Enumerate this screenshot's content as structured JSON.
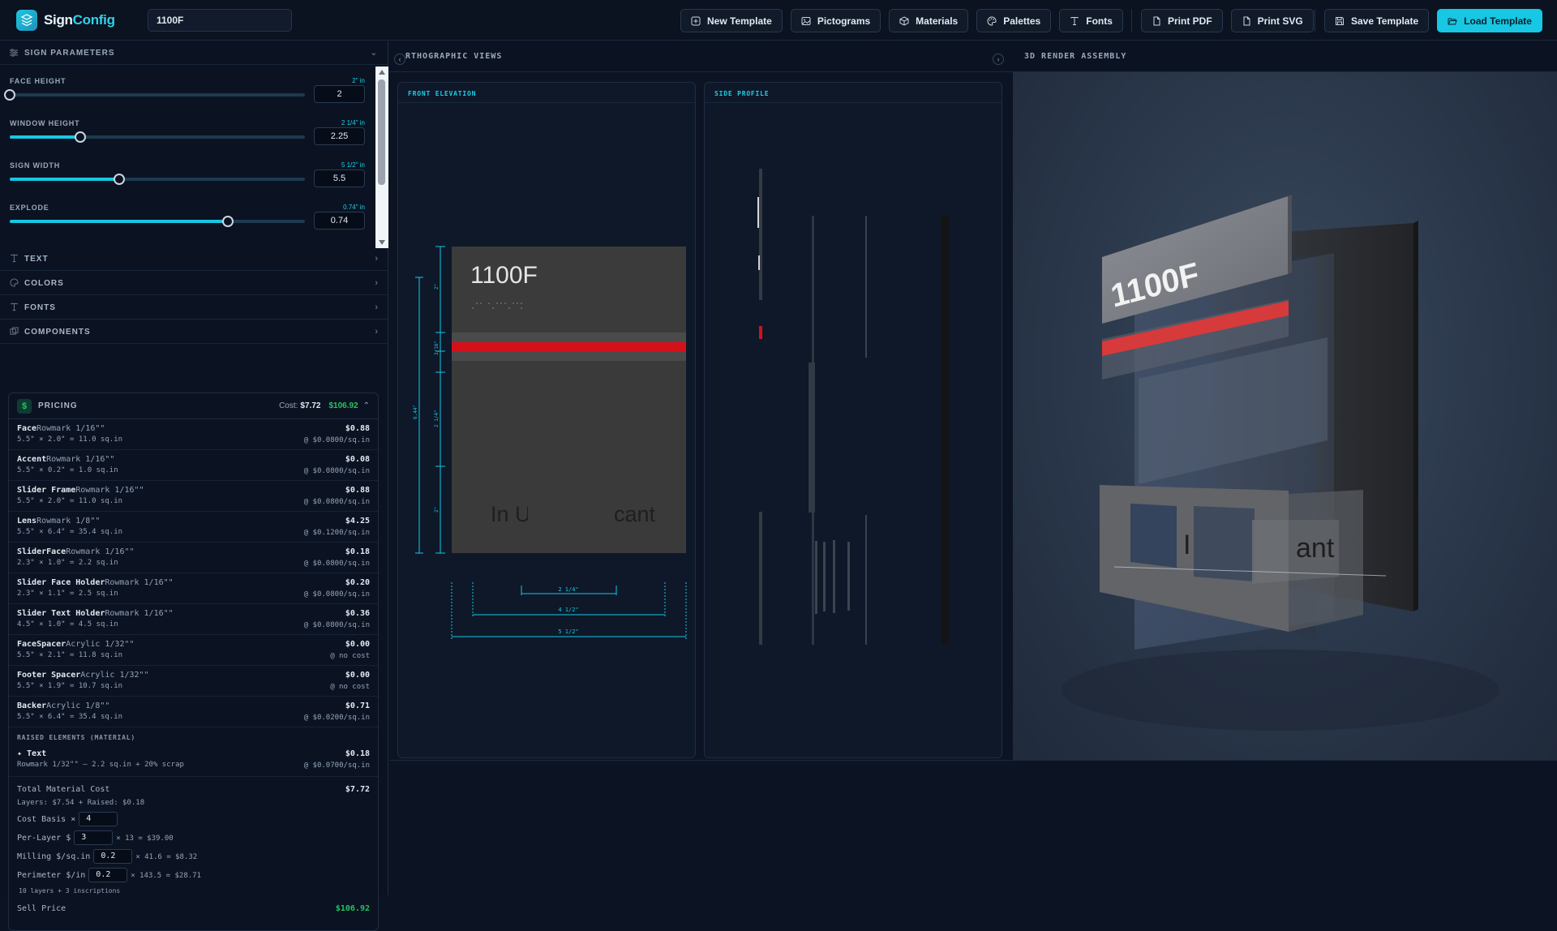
{
  "app": {
    "brand_a": "Sign",
    "brand_b": "Config",
    "template_name": "1100F"
  },
  "toolbar": {
    "new_template": "New Template",
    "pictograms": "Pictograms",
    "materials": "Materials",
    "palettes": "Palettes",
    "fonts": "Fonts",
    "print_pdf": "Print PDF",
    "print_svg": "Print SVG",
    "save_template": "Save Template",
    "load_template": "Load Template"
  },
  "sign_parameters": {
    "title": "SIGN PARAMETERS",
    "params": [
      {
        "label": "FACE HEIGHT",
        "display": "2\" in",
        "value": "2",
        "fraction": 0.0
      },
      {
        "label": "WINDOW HEIGHT",
        "display": "2 1/4\" in",
        "value": "2.25",
        "fraction": 0.24
      },
      {
        "label": "SIGN WIDTH",
        "display": "5 1/2\" in",
        "value": "5.5",
        "fraction": 0.37
      },
      {
        "label": "EXPLODE",
        "display": "0.74\" in",
        "value": "0.74",
        "fraction": 0.74
      }
    ]
  },
  "sections": {
    "text": "TEXT",
    "colors": "COLORS",
    "fonts": "FONTS",
    "components": "COMPONENTS"
  },
  "pricing": {
    "title": "PRICING",
    "cost_label": "Cost:",
    "cost": "$7.72",
    "sell": "$106.92",
    "rows": [
      {
        "name": "Face",
        "mat": "Rowmark 1/16\"\"",
        "dim": "5.5\" × 2.0\" = 11.0 sq.in",
        "amount": "$0.88",
        "rate": "@ $0.0800/sq.in"
      },
      {
        "name": "Accent",
        "mat": "Rowmark 1/16\"\"",
        "dim": "5.5\" × 0.2\" = 1.0 sq.in",
        "amount": "$0.08",
        "rate": "@ $0.0800/sq.in"
      },
      {
        "name": "Slider Frame",
        "mat": "Rowmark 1/16\"\"",
        "dim": "5.5\" × 2.0\" = 11.0 sq.in",
        "amount": "$0.88",
        "rate": "@ $0.0800/sq.in"
      },
      {
        "name": "Lens",
        "mat": "Rowmark 1/8\"\"",
        "dim": "5.5\" × 6.4\" = 35.4 sq.in",
        "amount": "$4.25",
        "rate": "@ $0.1200/sq.in"
      },
      {
        "name": "SliderFace",
        "mat": "Rowmark 1/16\"\"",
        "dim": "2.3\" × 1.0\" = 2.2 sq.in",
        "amount": "$0.18",
        "rate": "@ $0.0800/sq.in"
      },
      {
        "name": "Slider Face Holder",
        "mat": "Rowmark 1/16\"\"",
        "dim": "2.3\" × 1.1\" = 2.5 sq.in",
        "amount": "$0.20",
        "rate": "@ $0.0800/sq.in"
      },
      {
        "name": "Slider Text Holder",
        "mat": "Rowmark 1/16\"\"",
        "dim": "4.5\" × 1.0\" = 4.5 sq.in",
        "amount": "$0.36",
        "rate": "@ $0.0800/sq.in"
      },
      {
        "name": "FaceSpacer",
        "mat": "Acrylic 1/32\"\"",
        "dim": "5.5\" × 2.1\" = 11.8 sq.in",
        "amount": "$0.00",
        "rate": "@ no cost"
      },
      {
        "name": "Footer Spacer",
        "mat": "Acrylic 1/32\"\"",
        "dim": "5.5\" × 1.9\" = 10.7 sq.in",
        "amount": "$0.00",
        "rate": "@ no cost"
      },
      {
        "name": "Backer",
        "mat": "Acrylic 1/8\"\"",
        "dim": "5.5\" × 6.4\" = 35.4 sq.in",
        "amount": "$0.71",
        "rate": "@ $0.0200/sq.in"
      }
    ],
    "raised_heading": "RAISED ELEMENTS (MATERIAL)",
    "raised": {
      "name": "✦ Text",
      "dim": "Rowmark 1/32\"\" — 2.2 sq.in + 20% scrap",
      "amount": "$0.18",
      "rate": "@ $0.0700/sq.in"
    },
    "total_label": "Total Material Cost",
    "total_value": "$7.72",
    "layers_line": "Layers: $7.54 + Raised: $0.18",
    "cost_basis_label": "Cost Basis ×",
    "cost_basis": "4",
    "per_layer_label": "Per-Layer $",
    "per_layer": "3",
    "per_layer_calc": "× 13 = $39.00",
    "milling_label": "Milling $/sq.in",
    "milling": "0.2",
    "milling_calc": "× 41.6 = $8.32",
    "perimeter_label": "Perimeter $/in",
    "perimeter": "0.2",
    "perimeter_calc": "× 143.5 = $28.71",
    "layers_count": "10 layers  + 3 inscriptions",
    "sell_label": "Sell Price",
    "sell_value": "$106.92"
  },
  "ortho": {
    "title": "RTHOGRAPHIC VIEWS",
    "front_label": "FRONT ELEVATION",
    "side_label": "SIDE PROFILE",
    "sign_text": "1100F",
    "slider_left": "In U",
    "slider_right": "cant",
    "dims": {
      "d1": "2 1/4\"",
      "d2": "4 1/2\"",
      "d3": "5 1/2\"",
      "v_total": "6.44\"",
      "v_face": "2\"",
      "v_accent": "3/16\"",
      "v_window": "2 1/4\"",
      "v_footer": "2\""
    }
  },
  "render": {
    "title": "3D RENDER ASSEMBLY",
    "face_text": "1100F",
    "slider_text_left": "I",
    "slider_text_right": "ant"
  },
  "colors": {
    "accent": "#17c7e3",
    "red": "#d4111b",
    "green": "#22c55e"
  }
}
